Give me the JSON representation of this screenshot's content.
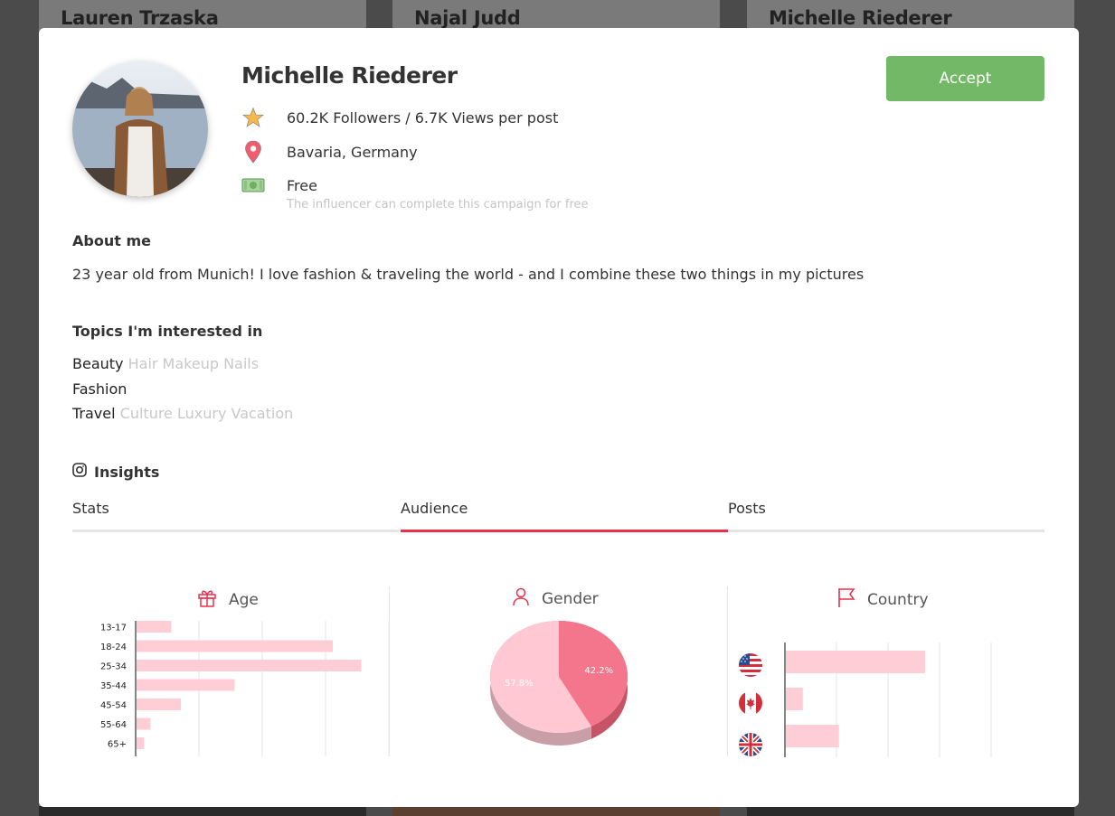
{
  "background_cards": [
    {
      "name": "Lauren Trzaska"
    },
    {
      "name": "Najal Judd"
    },
    {
      "name": "Michelle Riederer"
    }
  ],
  "profile": {
    "name": "Michelle Riederer",
    "stats": "60.2K Followers / 6.7K Views per post",
    "location": "Bavaria, Germany",
    "price": "Free",
    "price_note": "The influencer can complete this campaign for free",
    "accept_label": "Accept",
    "accept_color": "#72b866"
  },
  "about": {
    "title": "About me",
    "text": "23 year old from Munich! I love fashion & traveling the world - and I combine these two things in my pictures"
  },
  "topics": {
    "title": "Topics I'm interested in",
    "items": [
      {
        "main": "Beauty",
        "sub": "Hair Makeup Nails"
      },
      {
        "main": "Fashion",
        "sub": ""
      },
      {
        "main": "Travel",
        "sub": "Culture Luxury Vacation"
      }
    ]
  },
  "insights": {
    "title": "Insights",
    "tabs": [
      {
        "label": "Stats",
        "active": false
      },
      {
        "label": "Audience",
        "active": true
      },
      {
        "label": "Posts",
        "active": false
      }
    ],
    "accent_color": "#e8304f"
  },
  "panels": {
    "age_title": "Age",
    "gender_title": "Gender",
    "country_title": "Country"
  },
  "chart_data": [
    {
      "type": "bar",
      "orientation": "horizontal",
      "categories": [
        "13-17",
        "18-24",
        "25-34",
        "35-44",
        "45-54",
        "55-64",
        "65+"
      ],
      "values": [
        5.5,
        31,
        35.5,
        15.5,
        7,
        2.2,
        1.2
      ],
      "xlim": [
        0,
        45
      ],
      "grid": true,
      "color": "#ffcdd6"
    },
    {
      "type": "pie",
      "labels": [
        "",
        ""
      ],
      "values": [
        42.2,
        57.8
      ],
      "data_labels": [
        "42.2%",
        "57.8%"
      ],
      "colors": [
        "#f4768c",
        "#ffc8d2"
      ]
    },
    {
      "type": "bar",
      "orientation": "horizontal",
      "categories": [
        "us-flag-icon",
        "ca-flag-icon",
        "gb-flag-icon"
      ],
      "values": [
        27,
        3.3,
        10.3
      ],
      "xlim": [
        0,
        40
      ],
      "grid": true,
      "color": "#ffcdd6"
    }
  ]
}
